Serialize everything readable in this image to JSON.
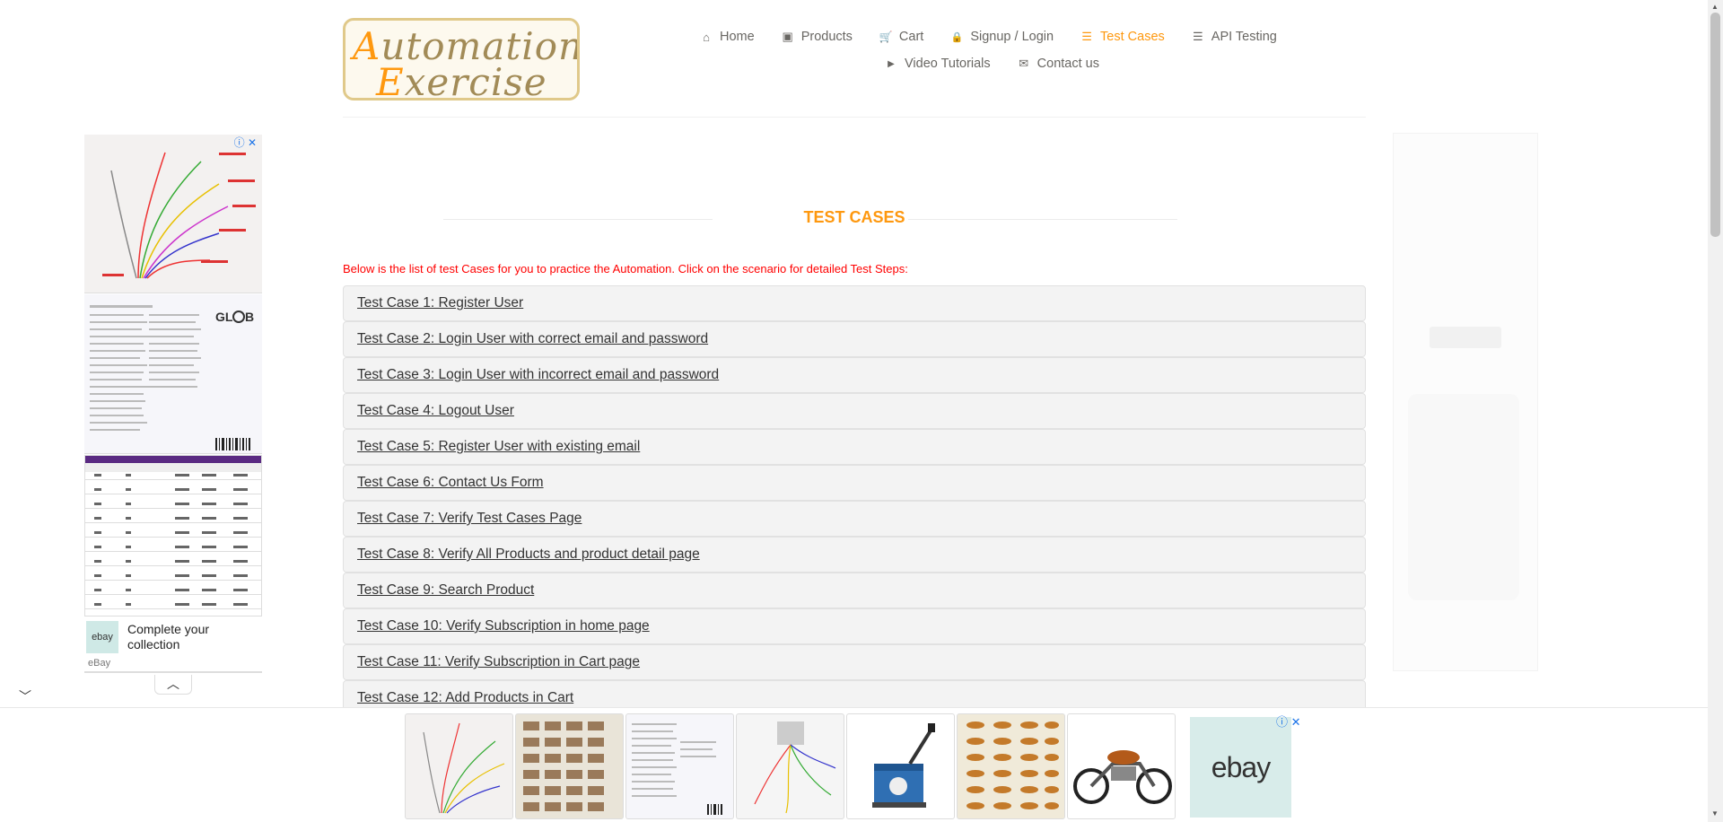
{
  "logo": {
    "line1_cap": "A",
    "line1_rest": "utomation",
    "line2_cap": "E",
    "line2_rest": "xercise"
  },
  "nav": {
    "items": [
      {
        "label": "Home",
        "icon": "home-icon",
        "glyph": "⌂"
      },
      {
        "label": "Products",
        "icon": "products-icon",
        "glyph": "▣"
      },
      {
        "label": "Cart",
        "icon": "cart-icon",
        "glyph": "🛒"
      },
      {
        "label": "Signup / Login",
        "icon": "lock-icon",
        "glyph": "🔒"
      },
      {
        "label": "Test Cases",
        "icon": "list-icon",
        "glyph": "☰"
      },
      {
        "label": "API Testing",
        "icon": "list-icon",
        "glyph": "☰"
      },
      {
        "label": "Video Tutorials",
        "icon": "youtube-icon",
        "glyph": "▶"
      },
      {
        "label": "Contact us",
        "icon": "envelope-icon",
        "glyph": "✉"
      }
    ],
    "active": "Test Cases"
  },
  "page": {
    "title": "TEST CASES",
    "intro": "Below is the list of test Cases for you to practice the Automation. Click on the scenario for detailed Test Steps:"
  },
  "test_cases": [
    "Test Case 1: Register User",
    "Test Case 2: Login User with correct email and password",
    "Test Case 3: Login User with incorrect email and password",
    "Test Case 4: Logout User",
    "Test Case 5: Register User with existing email",
    "Test Case 6: Contact Us Form",
    "Test Case 7: Verify Test Cases Page",
    "Test Case 8: Verify All Products and product detail page",
    "Test Case 9: Search Product",
    "Test Case 10: Verify Subscription in home page",
    "Test Case 11: Verify Subscription in Cart page",
    "Test Case 12: Add Products in Cart"
  ],
  "left_ad": {
    "cta": "Complete your collection",
    "brand": "eBay",
    "logo_text": "ebay",
    "info_icons": "ⓘ ✕"
  },
  "bottom_ad": {
    "logo_text": "ebay",
    "info_icons": "ⓘ ✕"
  },
  "colors": {
    "accent": "#FE980F",
    "intro_red": "#FF0000",
    "case_bg": "#F3F3F3"
  }
}
